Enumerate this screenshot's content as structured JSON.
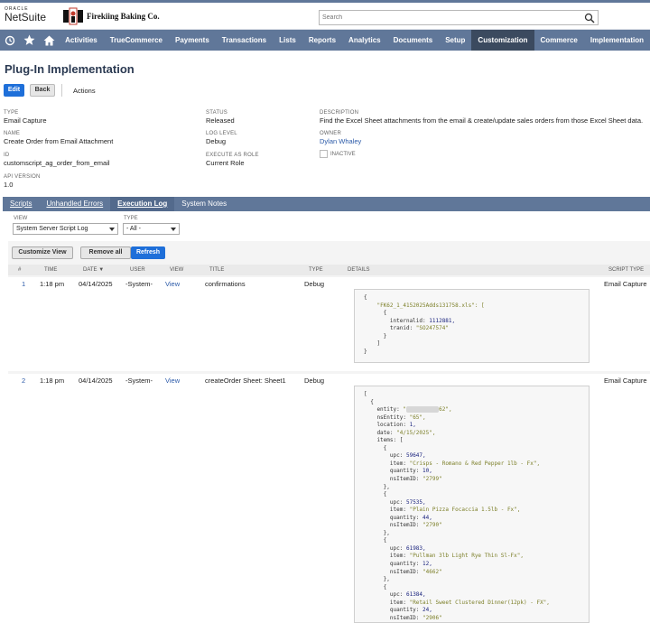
{
  "header": {
    "oracle": "ORACLE",
    "netsuite": "NetSuite",
    "company": "Firekiing Baking Co.",
    "search_placeholder": "Search"
  },
  "nav": {
    "icons": [
      "recent-records-icon",
      "star-icon",
      "home-icon"
    ],
    "items": [
      "Activities",
      "TrueCommerce",
      "Payments",
      "Transactions",
      "Lists",
      "Reports",
      "Analytics",
      "Documents",
      "Setup",
      "Customization",
      "Commerce",
      "Implementation"
    ],
    "active": "Customization"
  },
  "page": {
    "title": "Plug-In Implementation",
    "edit_label": "Edit",
    "back_label": "Back",
    "actions_label": "Actions"
  },
  "fields": {
    "type": {
      "label": "TYPE",
      "value": "Email Capture"
    },
    "name": {
      "label": "NAME",
      "value": "Create Order from Email Attachment"
    },
    "id": {
      "label": "ID",
      "value": "customscript_ag_order_from_email"
    },
    "api_version": {
      "label": "API VERSION",
      "value": "1.0"
    },
    "status": {
      "label": "STATUS",
      "value": "Released"
    },
    "log_level": {
      "label": "LOG LEVEL",
      "value": "Debug"
    },
    "execute_as_role": {
      "label": "EXECUTE AS ROLE",
      "value": "Current Role"
    },
    "description": {
      "label": "DESCRIPTION",
      "value": "Find the Excel Sheet attachments from the email & create/update sales orders from those Excel Sheet data."
    },
    "owner": {
      "label": "OWNER",
      "value": "Dylan Whaley"
    },
    "inactive": {
      "label": "INACTIVE",
      "checked": false
    }
  },
  "subtabs": {
    "scripts": "Scripts",
    "unhandled_errors": "Unhandled Errors",
    "execution_log": "Execution Log",
    "system_notes": "System Notes"
  },
  "filters": {
    "view_label": "VIEW",
    "view_value": "System Server Script Log",
    "type_label": "TYPE",
    "type_value": "- All -"
  },
  "log": {
    "customize_view_label": "Customize View",
    "remove_all_label": "Remove all",
    "refresh_label": "Refresh",
    "columns": {
      "num": "#",
      "time": "TIME",
      "date": "DATE ▼",
      "user": "USER",
      "view": "VIEW",
      "title": "TITLE",
      "type": "TYPE",
      "details": "DETAILS",
      "script_type": "SCRIPT TYPE"
    },
    "rows": [
      {
        "num": "1",
        "time": "1:18 pm",
        "date": "04/14/2025",
        "user": "-System-",
        "view": "View",
        "title": "confirmations",
        "type": "Debug",
        "script_type": "Email Capture",
        "details": {
          "file_key": "\"FK62_1_4152025Adds131758.xls\": [",
          "internal_id": "1112881,",
          "tran_id": "\"SO247574\""
        }
      },
      {
        "num": "2",
        "time": "1:18 pm",
        "date": "04/14/2025",
        "user": "-System-",
        "view": "View",
        "title": "createOrder Sheet: Sheet1",
        "type": "Debug",
        "script_type": "Email Capture",
        "details": {
          "entity_suffix": "62\",",
          "ns_entity": "\"65\",",
          "location": "1,",
          "date": "\"4/15/2025\",",
          "items": [
            {
              "upc": "59647,",
              "item": "\"Crisps - Romano & Red Pepper 1lb - Fx\",",
              "quantity": "10,",
              "ns_item_id": "\"2799\""
            },
            {
              "upc": "57535,",
              "item": "\"Plain Pizza Focaccia 1.5lb - Fx\",",
              "quantity": "44,",
              "ns_item_id": "\"2790\""
            },
            {
              "upc": "61983,",
              "item": "\"Pullman 3lb Light Rye Thin Sl-Fx\",",
              "quantity": "12,",
              "ns_item_id": "\"4662\""
            },
            {
              "upc": "61384,",
              "item": "\"Retail Sweet Clustered Dinner(12pk) - FX\",",
              "quantity": "24,",
              "ns_item_id": "\"2906\""
            }
          ]
        }
      }
    ]
  }
}
